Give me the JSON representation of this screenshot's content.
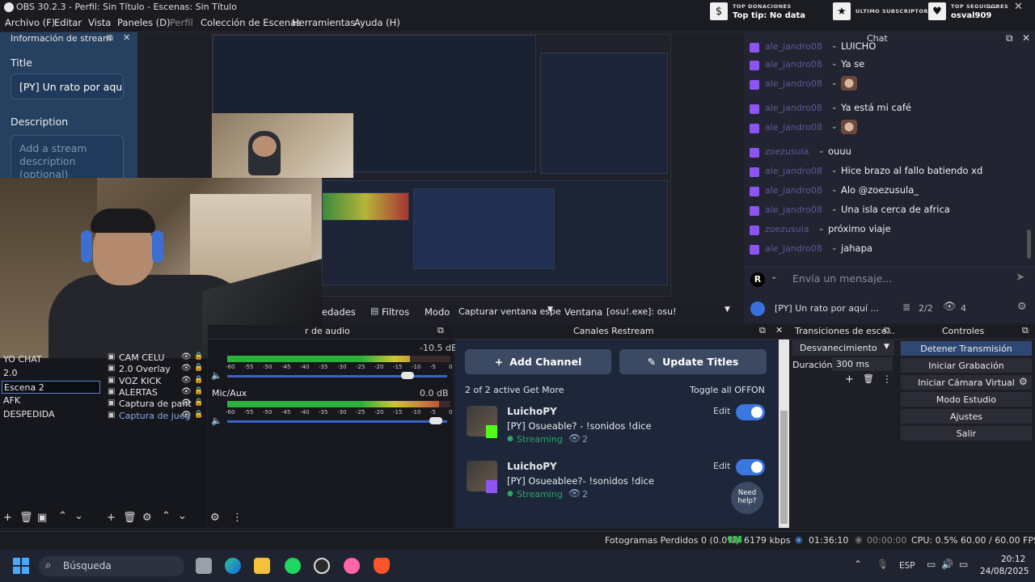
{
  "window": {
    "title": "OBS 30.2.3 - Perfil: Sin Título - Escenas: Sin Título"
  },
  "menu": [
    "Archivo (F)",
    "Editar",
    "Vista",
    "Paneles (D)",
    "Perfil",
    "Colección de Escenas",
    "Herramientas",
    "Ayuda (H)"
  ],
  "widgets": {
    "donations": {
      "label": "TOP DONACIONES",
      "value": "Top tip: No data"
    },
    "subscriber": {
      "label": "ULTIMO SUBSCRIPTOR",
      "value": ""
    },
    "followers": {
      "label": "TOP SEGUIDORES",
      "value": "osval909"
    }
  },
  "stream_info": {
    "dock_title": "Información de stream",
    "title_label": "Title",
    "title_value": "[PY] Un rato por aquí",
    "description_label": "Description",
    "description_placeholder": "Add a stream description (optional)"
  },
  "chat": {
    "dock_title": "Chat",
    "messages": [
      {
        "user": "ale_jandro08",
        "text": "LUICHO"
      },
      {
        "user": "ale_jandro08",
        "text": "Ya se"
      },
      {
        "user": "ale_jandro08",
        "text": ""
      },
      {
        "user": "ale_jandro08",
        "text": "Ya está mi café"
      },
      {
        "user": "ale_jandro08",
        "text": ""
      },
      {
        "user": "zoezusula",
        "text": "ouuu"
      },
      {
        "user": "ale_jandro08",
        "text": "Hice brazo al fallo batiendo xd"
      },
      {
        "user": "ale_jandro08",
        "text": "Alo @zoezusula_"
      },
      {
        "user": "ale_jandro08",
        "text": "Una isla cerca de africa"
      },
      {
        "user": "zoezusula",
        "text": "próximo viaje"
      },
      {
        "user": "ale_jandro08",
        "text": "jahapa"
      }
    ],
    "avatar_letter": "R",
    "input_placeholder": "Envía un mensaje...",
    "stream_title": "[PY] Un rato por aquí ...",
    "platforms": "2/2",
    "viewers": "4"
  },
  "preview_controls": {
    "properties": "edades",
    "filters": "Filtros",
    "mode_label": "Modo",
    "mode_value": "Capturar ventana espe",
    "window_label": "Ventana",
    "window_value": "[osu!.exe]: osu!"
  },
  "scenes": {
    "items": [
      "YO CHAT",
      "2.0",
      "Escena 2",
      "AFK",
      "DESPEDIDA"
    ],
    "selected": "Escena 2"
  },
  "sources": {
    "items": [
      "CAM CELU",
      "2.0 Overlay",
      "VOZ KICK",
      "ALERTAS",
      "Captura de pant",
      "Captura de jueg"
    ]
  },
  "mixer": {
    "dock_title": "r de audio",
    "channels": [
      {
        "name": "",
        "db": "-10.5 dB",
        "level": 0.82
      },
      {
        "name": "Mic/Aux",
        "db": "0.0 dB",
        "level": 0.95
      }
    ],
    "scale": [
      "-60",
      "-55",
      "-50",
      "-45",
      "-40",
      "-35",
      "-30",
      "-25",
      "-20",
      "-15",
      "-10",
      "-5",
      "0"
    ]
  },
  "restream": {
    "dock_title": "Canales Restream",
    "add_channel": "Add Channel",
    "update_titles": "Update Titles",
    "summary": "2 of 2 active Get More",
    "toggle_all": "Toggle all OFF",
    "on_label": "ON",
    "channels": [
      {
        "name": "LuichoPY",
        "title": "[PY] Osueable? - !sonidos !dice",
        "status": "Streaming",
        "viewers": "2",
        "edit": "Edit"
      },
      {
        "name": "LuichoPY",
        "title": "[PY] Osueablee?- !sonidos !dice",
        "status": "Streaming",
        "viewers": "2",
        "edit": "Edit"
      }
    ],
    "help": "Need help?"
  },
  "transitions": {
    "dock_title": "Transiciones de esce...",
    "type": "Desvanecimiento",
    "duration_label": "Duración",
    "duration_value": "300 ms"
  },
  "controls": {
    "dock_title": "Controles",
    "buttons": [
      "Detener Transmisión",
      "Iniciar Grabación",
      "Iniciar Cámara Virtual",
      "Modo Estudio",
      "Ajustes",
      "Salir"
    ]
  },
  "status": {
    "dropped": "Fotogramas Perdidos 0 (0.0%)",
    "bitrate": "6179 kbps",
    "stream_time": "01:36:10",
    "rec_time": "00:00:00",
    "cpu": "CPU: 0.5%",
    "fps": "60.00 / 60.00 FPS"
  },
  "taskbar": {
    "search_placeholder": "Búsqueda",
    "lang": "ESP",
    "time": "20:12",
    "date": "24/08/2025"
  },
  "colors": {
    "accent": "#3a78e0",
    "twitch": "#8c55f1",
    "kick": "#53fc18",
    "restream_bg": "#1d2739"
  }
}
